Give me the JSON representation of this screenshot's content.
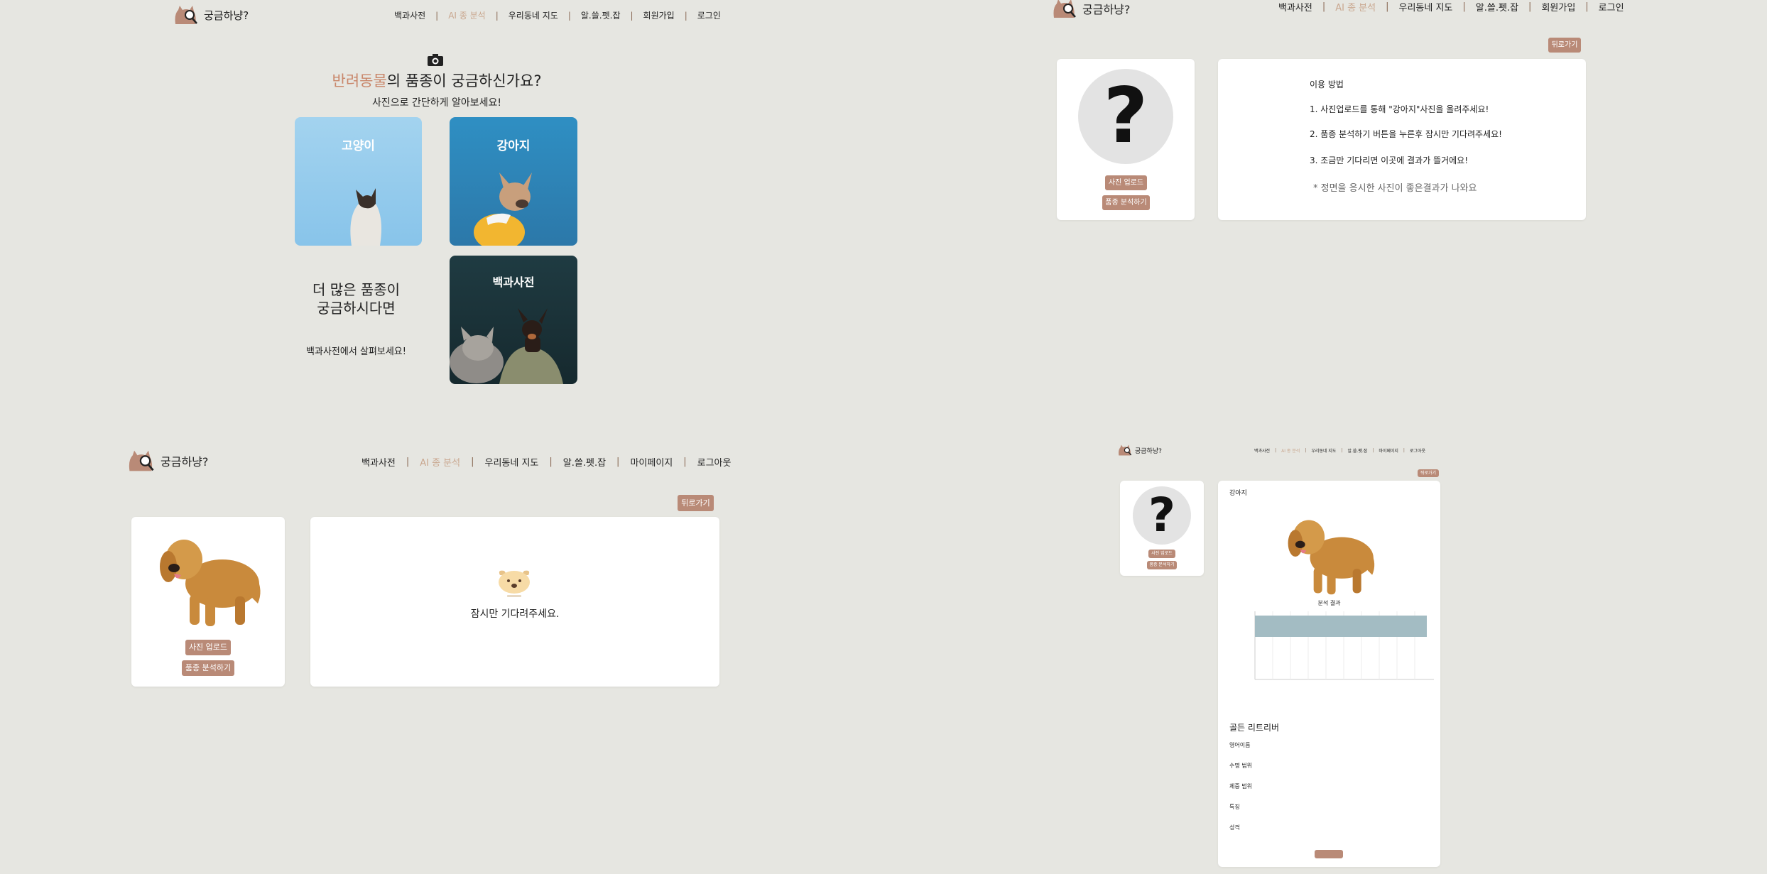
{
  "brand": "궁금하냥?",
  "colors": {
    "background": "#e6e6e1",
    "accent": "#b98a77",
    "active_nav": "#c9a78f",
    "highlight_text": "#c9876b",
    "chart_bar": "#a3bcc3"
  },
  "panel1": {
    "nav": [
      "백과사전",
      "AI 종 분석",
      "우리동네 지도",
      "알.쓸.펫.잡",
      "회원가입",
      "로그인"
    ],
    "title_highlight": "반려동물",
    "title_rest": "의 품종이 궁금하신가요?",
    "subtitle": "사진으로 간단하게 알아보세요!",
    "tiles": {
      "cat": "고양이",
      "dog": "강아지",
      "encyclopedia": "백과사전"
    },
    "more_title_1": "더 많은 품종이",
    "more_title_2": "궁금하시다면",
    "more_sub": "백과사전에서 살펴보세요!"
  },
  "panel2": {
    "nav": [
      "백과사전",
      "AI 종 분석",
      "우리동네 지도",
      "알.쓸.펫.잡",
      "회원가입",
      "로그인"
    ],
    "back": "뒤로가기",
    "upload": "사진 업로드",
    "analyze": "품종 분석하기",
    "howto_title": "이용 방법",
    "steps": [
      "1. 사진업로드를 통해 \"강아지\"사진을 올려주세요!",
      "2. 품종 분석하기 버튼을 누른후 잠시만 기다려주세요!",
      "3. 조금만 기다리면 이곳에 결과가 뜰거에요!"
    ],
    "note": "* 정면을 응시한 사진이 좋은결과가 나와요"
  },
  "panel3": {
    "nav": [
      "백과사전",
      "AI 종 분석",
      "우리동네 지도",
      "알.쓸.펫.잡",
      "마이페이지",
      "로그아웃"
    ],
    "back": "뒤로가기",
    "upload": "사진 업로드",
    "analyze": "품종 분석하기",
    "loading": "잠시만 기다려주세요."
  },
  "panel4": {
    "nav": [
      "백과사전",
      "AI 종 분석",
      "우리동네 지도",
      "알.쓸.펫.잡",
      "마이페이지",
      "로그아웃"
    ],
    "back": "뒤로가기",
    "upload": "사진 업로드",
    "analyze": "품종 분석하기",
    "result_label": "강아지",
    "chart_title": "분석 결과",
    "breed_name": "골든 리트리버",
    "info": [
      {
        "label": "영어이름"
      },
      {
        "label": "수명 범위"
      },
      {
        "label": "체중 범위"
      },
      {
        "label": "특징"
      },
      {
        "label": "성격"
      }
    ]
  }
}
